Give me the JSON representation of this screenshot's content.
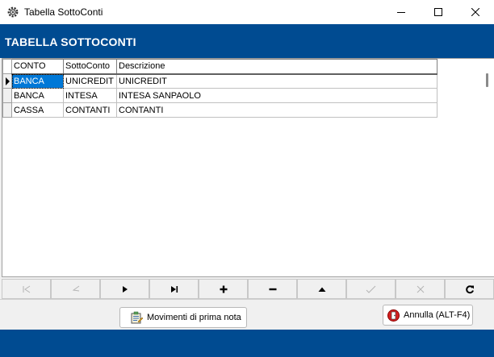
{
  "window": {
    "title": "Tabella SottoConti"
  },
  "header": {
    "title": "TABELLA SOTTOCONTI",
    "band_color": "#004b91"
  },
  "grid": {
    "columns": [
      "CONTO",
      "SottoConto",
      "Descrizione"
    ],
    "rows": [
      [
        "BANCA",
        "UNICREDIT",
        "UNICREDIT"
      ],
      [
        "BANCA",
        "INTESA",
        "INTESA SANPAOLO"
      ],
      [
        "CASSA",
        "CONTANTI",
        "CONTANTI"
      ]
    ],
    "selected_row": 0,
    "selection_color": "#0078d7"
  },
  "navigator": {
    "buttons": [
      {
        "icon": "first-record-icon",
        "enabled": false
      },
      {
        "icon": "prior-record-icon",
        "enabled": false
      },
      {
        "icon": "next-record-icon",
        "enabled": true
      },
      {
        "icon": "last-record-icon",
        "enabled": true
      },
      {
        "icon": "insert-record-icon",
        "enabled": true
      },
      {
        "icon": "delete-record-icon",
        "enabled": true
      },
      {
        "icon": "edit-record-icon",
        "enabled": true
      },
      {
        "icon": "post-record-icon",
        "enabled": false
      },
      {
        "icon": "cancel-edit-icon",
        "enabled": false
      },
      {
        "icon": "refresh-icon",
        "enabled": true
      }
    ]
  },
  "actions": {
    "movimenti_label": "Movimenti di prima nota",
    "annulla_label": "Annulla (ALT-F4)"
  }
}
